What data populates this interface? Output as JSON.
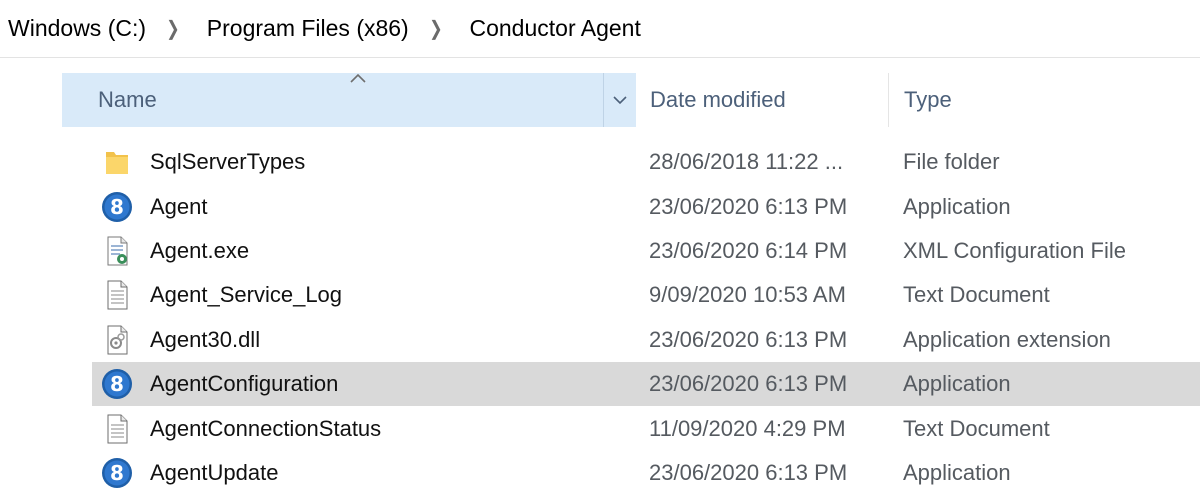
{
  "breadcrumb": {
    "items": [
      "Windows (C:)",
      "Program Files (x86)",
      "Conductor Agent"
    ]
  },
  "columns": {
    "name": "Name",
    "date_modified": "Date modified",
    "type": "Type"
  },
  "files": [
    {
      "name": "SqlServerTypes",
      "date": "28/06/2018 11:22 ...",
      "type": "File folder",
      "icon": "folder-icon"
    },
    {
      "name": "Agent",
      "date": "23/06/2020 6:13 PM",
      "type": "Application",
      "icon": "app-icon"
    },
    {
      "name": "Agent.exe",
      "date": "23/06/2020 6:14 PM",
      "type": "XML Configuration File",
      "icon": "config-file-icon"
    },
    {
      "name": "Agent_Service_Log",
      "date": "9/09/2020 10:53 AM",
      "type": "Text Document",
      "icon": "text-document-icon"
    },
    {
      "name": "Agent30.dll",
      "date": "23/06/2020 6:13 PM",
      "type": "Application extension",
      "icon": "dll-file-icon"
    },
    {
      "name": "AgentConfiguration",
      "date": "23/06/2020 6:13 PM",
      "type": "Application",
      "icon": "app-icon",
      "selected": true
    },
    {
      "name": "AgentConnectionStatus",
      "date": "11/09/2020 4:29 PM",
      "type": "Text Document",
      "icon": "text-document-icon"
    },
    {
      "name": "AgentUpdate",
      "date": "23/06/2020 6:13 PM",
      "type": "Application",
      "icon": "app-icon"
    }
  ],
  "colors": {
    "header_bg": "#d9eaf9",
    "selected_row_bg": "#d9d9d9",
    "app_icon_blue": "#1f5fa8"
  }
}
